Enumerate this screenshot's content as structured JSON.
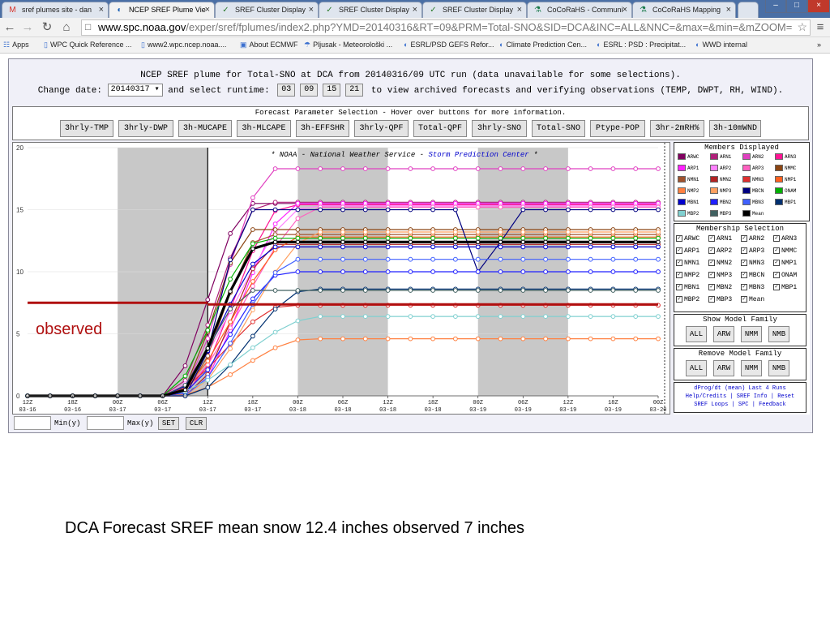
{
  "browser": {
    "tabs": [
      {
        "label": "sref plumes site - dan",
        "icon": "gmail-icon",
        "active": false
      },
      {
        "label": "NCEP SREF Plume Vie",
        "icon": "spc-icon",
        "active": true
      },
      {
        "label": "SREF Cluster Display",
        "icon": "check-icon",
        "active": false
      },
      {
        "label": "SREF Cluster Display",
        "icon": "check-icon",
        "active": false
      },
      {
        "label": "SREF Cluster Display",
        "icon": "check-icon",
        "active": false
      },
      {
        "label": "CoCoRaHS - Communi",
        "icon": "cocorahs-icon",
        "active": false
      },
      {
        "label": "CoCoRaHS Mapping",
        "icon": "cocorahs-icon",
        "active": false
      }
    ],
    "url_host": "www.spc.noaa.gov",
    "url_path": "/exper/sref/fplumes/index2.php?YMD=20140316&RT=09&PRM=Total-SNO&SID=DCA&INC=ALL&NNC=&max=&min=&mZOOM=",
    "bookmarks": [
      "Apps",
      "WPC Quick Reference ...",
      "www2.wpc.ncep.noaa....",
      "About ECMWF",
      "Pljusak - Meteorološki ...",
      "ESRL/PSD GEFS Refor...",
      "Climate Prediction Cen...",
      "ESRL : PSD : Precipitat...",
      "WWD internal"
    ]
  },
  "page": {
    "title": "NCEP SREF plume for Total-SNO at DCA from 20140316/09 UTC run (data unavailable for some selections).",
    "change_date_label": "Change date:",
    "date_value": "20140317",
    "runtime_label": "and select runtime:",
    "runtimes": [
      "03",
      "09",
      "15",
      "21"
    ],
    "runtime_suffix": "to view archived forecasts and verifying observations (TEMP, DWPT, RH, WIND).",
    "param_title": "Forecast Parameter Selection - Hover over buttons for more information.",
    "param_buttons": [
      "3hrly-TMP",
      "3hrly-DWP",
      "3h-MUCAPE",
      "3h-MLCAPE",
      "3h-EFFSHR",
      "3hrly-QPF",
      "Total-QPF",
      "3hrly-SNO",
      "Total-SNO",
      "Ptype-POP",
      "3hr-2mRH%",
      "3h-10mWND"
    ],
    "members_title": "Members Displayed",
    "members": [
      {
        "name": "ARWC",
        "color": "#800060"
      },
      {
        "name": "ARN1",
        "color": "#b0207a"
      },
      {
        "name": "ARN2",
        "color": "#e040c0"
      },
      {
        "name": "ARN3",
        "color": "#ff1493"
      },
      {
        "name": "ARP1",
        "color": "#ff20ff"
      },
      {
        "name": "ARP2",
        "color": "#ff80ff"
      },
      {
        "name": "ARP3",
        "color": "#ff60c0"
      },
      {
        "name": "NMMC",
        "color": "#8b4513"
      },
      {
        "name": "NMN1",
        "color": "#a0522d"
      },
      {
        "name": "NMN2",
        "color": "#b22222"
      },
      {
        "name": "NMN3",
        "color": "#e03030"
      },
      {
        "name": "NMP1",
        "color": "#ff6020"
      },
      {
        "name": "NMP2",
        "color": "#ff8040"
      },
      {
        "name": "NMP3",
        "color": "#ffa060"
      },
      {
        "name": "MBCN",
        "color": "#000080"
      },
      {
        "name": "ONAM",
        "color": "#00b000"
      },
      {
        "name": "MBN1",
        "color": "#0000cd"
      },
      {
        "name": "MBN2",
        "color": "#2020ff"
      },
      {
        "name": "MBN3",
        "color": "#4060ff"
      },
      {
        "name": "MBP1",
        "color": "#003070"
      },
      {
        "name": "MBP2",
        "color": "#80d0d0"
      },
      {
        "name": "MBP3",
        "color": "#406060"
      },
      {
        "name": "Mean",
        "color": "#000000"
      }
    ],
    "membership_title": "Membership Selection",
    "membership_items": [
      "ARWC",
      "ARN1",
      "ARN2",
      "ARN3",
      "ARP1",
      "ARP2",
      "ARP3",
      "NMMC",
      "NMN1",
      "NMN2",
      "NMN3",
      "NMP1",
      "NMP2",
      "NMP3",
      "MBCN",
      "ONAM",
      "MBN1",
      "MBN2",
      "MBN3",
      "MBP1",
      "MBP2",
      "MBP3",
      "Mean"
    ],
    "show_family_title": "Show Model Family",
    "remove_family_title": "Remove Model Family",
    "family_buttons": [
      "ALL",
      "ARW",
      "NMM",
      "NMB"
    ],
    "links_line1": "dProg/dt (mean) Last 4 Runs",
    "links_line2": "Help/Credits | SREF Info | Reset",
    "links_line3": "SREF Loops | SPC | Feedback",
    "min_label": "Min(y)",
    "max_label": "Max(y)",
    "set_label": "SET",
    "clr_label": "CLR"
  },
  "chart_data": {
    "type": "line",
    "banner_prefix": "* NOAA - National Weather Service - ",
    "banner_spc": "Storm Prediction Center",
    "banner_suffix": " *",
    "y_ticks": [
      0,
      5,
      10,
      15,
      20
    ],
    "ylim": [
      0,
      20
    ],
    "x_labels": [
      [
        "12Z",
        "03-16"
      ],
      [
        "18Z",
        "03-16"
      ],
      [
        "00Z",
        "03-17"
      ],
      [
        "06Z",
        "03-17"
      ],
      [
        "12Z",
        "03-17"
      ],
      [
        "18Z",
        "03-17"
      ],
      [
        "00Z",
        "03-18"
      ],
      [
        "06Z",
        "03-18"
      ],
      [
        "12Z",
        "03-18"
      ],
      [
        "18Z",
        "03-18"
      ],
      [
        "00Z",
        "03-19"
      ],
      [
        "06Z",
        "03-19"
      ],
      [
        "12Z",
        "03-19"
      ],
      [
        "18Z",
        "03-19"
      ],
      [
        "00Z",
        "03-20"
      ]
    ],
    "x_hours": [
      0,
      84
    ],
    "shaded_night_bands_hours": [
      [
        12,
        24
      ],
      [
        36,
        48
      ],
      [
        60,
        72
      ]
    ],
    "current_time_hour": 24,
    "observed_value": 7.5,
    "observed_label": "observed",
    "series_final_values": {
      "ARWC": 15.5,
      "ARN1": 15.6,
      "ARN2": 18.3,
      "ARN3": 15.4,
      "ARP1": 15.5,
      "ARP2": 15.3,
      "ARP3": 15.2,
      "NMMC": 13.4,
      "NMN1": 13.0,
      "NMN2": 12.2,
      "NMN3": 7.3,
      "NMP1": 12.8,
      "NMP2": 4.6,
      "NMP3": 13.2,
      "MBCN": 15.0,
      "ONAM": 12.7,
      "MBN1": 12.0,
      "MBN2": 10.0,
      "MBN3": 11.0,
      "MBP1": 8.6,
      "MBP2": 6.4,
      "MBP3": 8.5,
      "Mean": 12.4
    }
  },
  "caption": "DCA Forecast SREF mean snow 12.4 inches observed 7 inches"
}
